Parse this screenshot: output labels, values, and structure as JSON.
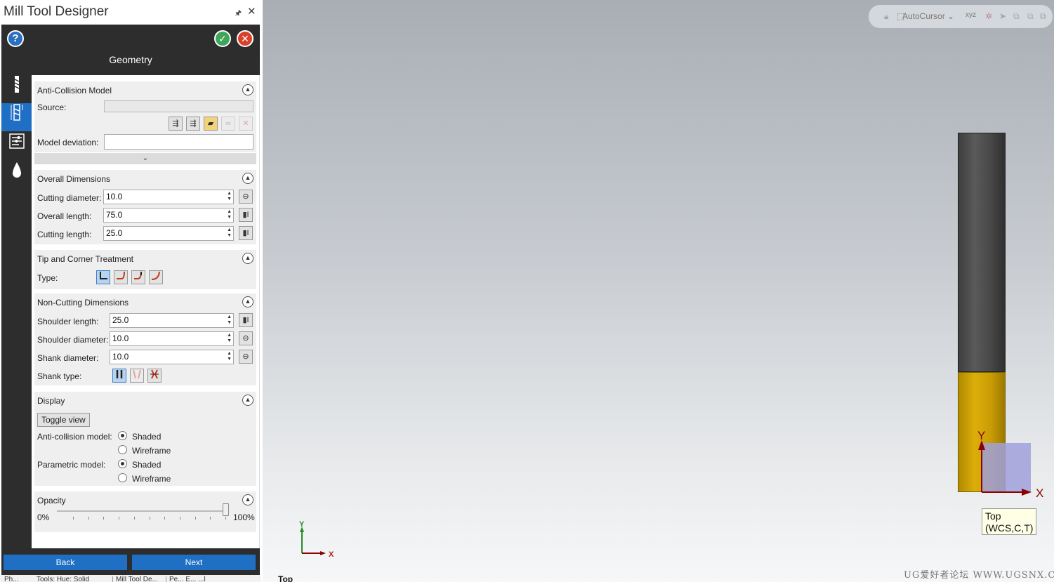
{
  "window": {
    "title": "Mill Tool Designer"
  },
  "header": {
    "title": "Geometry"
  },
  "sections": {
    "anti_collision": {
      "title": "Anti-Collision Model",
      "source_label": "Source:",
      "source_value": "",
      "deviation_label": "Model deviation:",
      "deviation_value": ""
    },
    "overall": {
      "title": "Overall Dimensions",
      "cutting_diameter_label": "Cutting diameter:",
      "cutting_diameter_value": "10.0",
      "overall_length_label": "Overall length:",
      "overall_length_value": "75.0",
      "cutting_length_label": "Cutting length:",
      "cutting_length_value": "25.0"
    },
    "tip": {
      "title": "Tip and Corner Treatment",
      "type_label": "Type:"
    },
    "non_cutting": {
      "title": "Non-Cutting Dimensions",
      "shoulder_length_label": "Shoulder length:",
      "shoulder_length_value": "25.0",
      "shoulder_diameter_label": "Shoulder diameter:",
      "shoulder_diameter_value": "10.0",
      "shank_diameter_label": "Shank diameter:",
      "shank_diameter_value": "10.0",
      "shank_type_label": "Shank type:"
    },
    "display": {
      "title": "Display",
      "toggle_label": "Toggle view",
      "anti_collision_label": "Anti-collision model:",
      "parametric_label": "Parametric model:",
      "shaded": "Shaded",
      "wireframe": "Wireframe",
      "anti_collision_selected": "Shaded",
      "parametric_selected": "Shaded"
    },
    "opacity": {
      "title": "Opacity",
      "min_label": "0%",
      "max_label": "100%",
      "value_percent": 100
    }
  },
  "nav": {
    "back": "Back",
    "next": "Next"
  },
  "bottom_tabs": [
    "Ph...",
    "Tools: Hue: Solid",
    "Mill Tool De...",
    "Pe... E... ...l"
  ],
  "viewport": {
    "autocursor_label": "AutoCursor",
    "triad_x": "X",
    "triad_y": "Y",
    "view_label_line1": "Top",
    "view_label_line2": "(WCS,C,T)",
    "mini_x": "X",
    "mini_y": "Y",
    "view_name": "Top",
    "watermark": "UG爱好者论坛 WWW.UGSNX.COM"
  },
  "colors": {
    "accent_blue": "#1f6fc5",
    "dark_panel": "#2d2d2d",
    "tool_shank": "#4a4a4a",
    "tool_flute": "#d9aa08",
    "triad_red": "#8b0000"
  },
  "icons": {
    "side_tabs": [
      "end-mill-icon",
      "tool-geometry-icon",
      "tool-properties-icon",
      "tool-holder-icon"
    ],
    "source_buttons": [
      "import-model-icon",
      "import-assembly-icon",
      "open-folder-icon",
      "link-icon",
      "delete-icon"
    ],
    "tip_types": [
      "flat-tip-icon",
      "corner-radius-icon",
      "chamfer-tip-icon",
      "ball-tip-icon"
    ],
    "shank_types": [
      "straight-shank-icon",
      "tapered-shank-icon",
      "necked-shank-icon"
    ]
  }
}
